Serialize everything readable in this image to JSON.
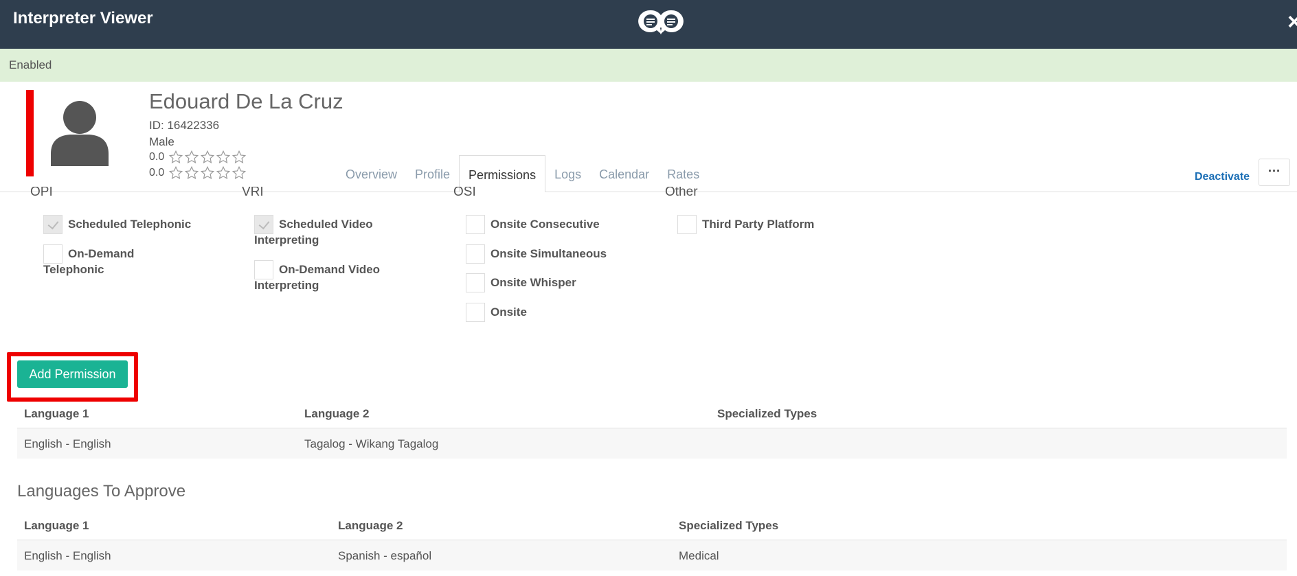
{
  "window": {
    "title": "Interpreter Viewer",
    "close_icon": "×"
  },
  "status": {
    "label": "Enabled",
    "color": "#dff0d8"
  },
  "profile": {
    "name": "Edouard De La Cruz",
    "id_label": "ID: 16422336",
    "gender": "Male",
    "rating_1": "0.0",
    "rating_2": "0.0",
    "accent_color": "#ee0000"
  },
  "tabs": [
    {
      "label": "Overview"
    },
    {
      "label": "Profile"
    },
    {
      "label": "Permissions"
    },
    {
      "label": "Logs"
    },
    {
      "label": "Calendar"
    },
    {
      "label": "Rates"
    }
  ],
  "active_tab": "Permissions",
  "actions": {
    "deactivate_label": "Deactivate",
    "more_label": "···"
  },
  "permissions": {
    "opi": {
      "heading": "OPI",
      "items": [
        {
          "label": "Scheduled Telephonic",
          "checked": true
        },
        {
          "label_line1": "On-Demand",
          "label_line2": "Telephonic",
          "checked": false
        }
      ]
    },
    "vri": {
      "heading": "VRI",
      "items": [
        {
          "label_line1": "Scheduled Video",
          "label_line2": "Interpreting",
          "checked": true
        },
        {
          "label_line1": "On-Demand Video",
          "label_line2": "Interpreting",
          "checked": false
        }
      ]
    },
    "osi": {
      "heading": "OSI",
      "items": [
        {
          "label": "Onsite Consecutive",
          "checked": false
        },
        {
          "label": "Onsite Simultaneous",
          "checked": false
        },
        {
          "label": "Onsite Whisper",
          "checked": false
        },
        {
          "label": "Onsite",
          "checked": false
        }
      ]
    },
    "other": {
      "heading": "Other",
      "items": [
        {
          "label": "Third Party Platform",
          "checked": false
        }
      ]
    }
  },
  "add_permission": {
    "label": "Add Permission",
    "color": "#1ab394"
  },
  "languages_table": {
    "headers": [
      "Language 1",
      "Language 2",
      "Specialized Types"
    ],
    "rows": [
      [
        "English - English",
        "Tagalog - Wikang Tagalog",
        ""
      ]
    ]
  },
  "approve_section": {
    "title": "Languages To Approve",
    "headers": [
      "Language 1",
      "Language 2",
      "Specialized Types"
    ],
    "rows": [
      [
        "English - English",
        "Spanish - español",
        "Medical"
      ]
    ]
  }
}
